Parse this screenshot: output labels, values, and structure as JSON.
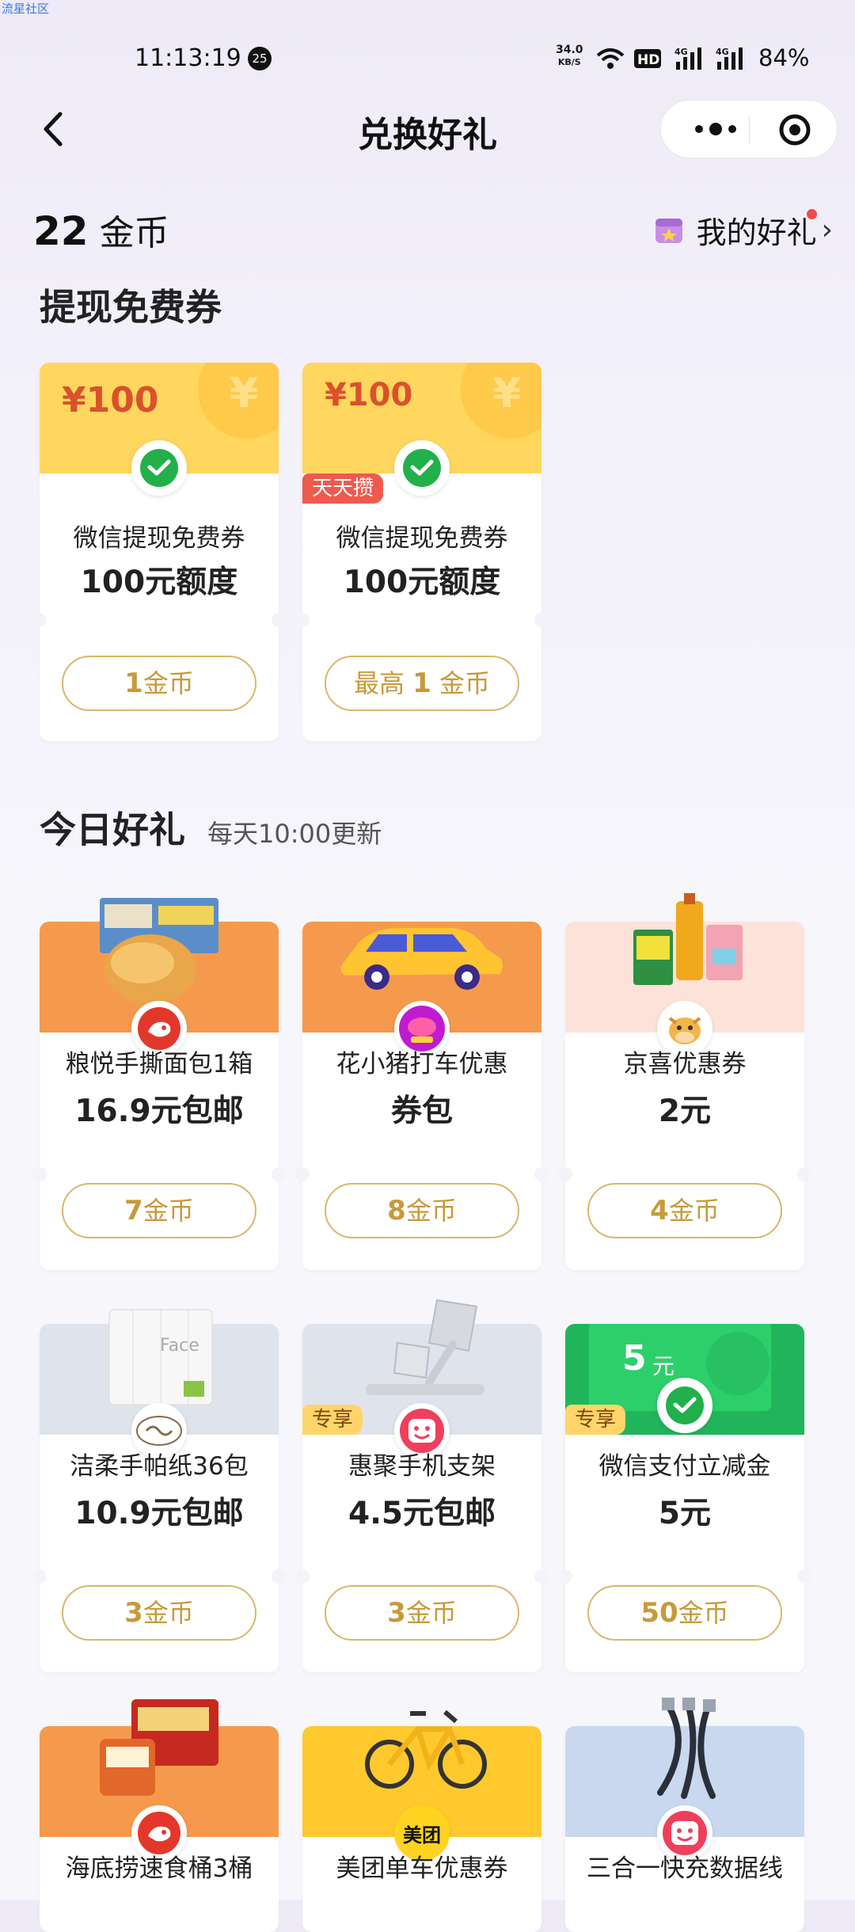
{
  "watermark": "流星社区",
  "status": {
    "time": "11:13:19",
    "notif_count": "25",
    "net_speed_value": "34.0",
    "net_speed_unit": "KB/S",
    "battery": "84%"
  },
  "nav": {
    "title": "兑换好礼"
  },
  "header": {
    "coin_count": "22",
    "coin_unit": "金币",
    "my_gifts": "我的好礼"
  },
  "sections": {
    "withdraw": {
      "title": "提现免费券"
    },
    "today": {
      "title": "今日好礼",
      "subtitle": "每天10:00更新"
    }
  },
  "withdraw_cards": [
    {
      "amount": "¥100",
      "name": "微信提现免费券",
      "value": "100元额度",
      "button_prefix": "",
      "button_num": "1",
      "button_unit": "金币",
      "tag": ""
    },
    {
      "amount": "¥100",
      "name": "微信提现免费券",
      "value": "100元额度",
      "button_prefix": "最高 ",
      "button_num": "1",
      "button_unit": " 金币",
      "tag": "天天攒"
    }
  ],
  "gift_cards": [
    {
      "name": "粮悦手撕面包1箱",
      "value": "16.9元包邮",
      "button_num": "7",
      "button_unit": "金币",
      "tag": ""
    },
    {
      "name": "花小猪打车优惠",
      "value": "券包",
      "button_num": "8",
      "button_unit": "金币",
      "tag": ""
    },
    {
      "name": "京喜优惠券",
      "value": "2元",
      "button_num": "4",
      "button_unit": "金币",
      "tag": ""
    },
    {
      "name": "洁柔手帕纸36包",
      "value": "10.9元包邮",
      "button_num": "3",
      "button_unit": "金币",
      "tag": ""
    },
    {
      "name": "惠聚手机支架",
      "value": "4.5元包邮",
      "button_num": "3",
      "button_unit": "金币",
      "tag": "专享"
    },
    {
      "name": "微信支付立减金",
      "value": "5元",
      "button_num": "50",
      "button_unit": "金币",
      "tag": "专享",
      "banner_amount": "5",
      "banner_unit": "元"
    },
    {
      "name": "海底捞速食桶3桶",
      "value": ""
    },
    {
      "name": "美团单车优惠券",
      "value": "",
      "logo_text": "美团"
    },
    {
      "name": "三合一快充数据线",
      "value": ""
    }
  ],
  "colors": {
    "accent_gold": "#c79a3a",
    "wechat_green": "#22b04b",
    "tag_red": "#ef5a4f"
  }
}
